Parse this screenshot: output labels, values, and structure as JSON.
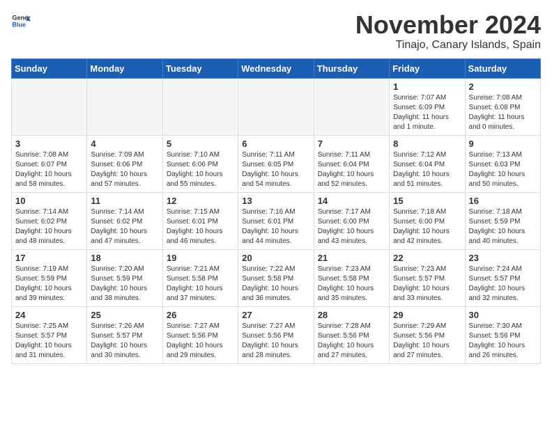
{
  "header": {
    "logo_general": "General",
    "logo_blue": "Blue",
    "month": "November 2024",
    "location": "Tinajo, Canary Islands, Spain"
  },
  "weekdays": [
    "Sunday",
    "Monday",
    "Tuesday",
    "Wednesday",
    "Thursday",
    "Friday",
    "Saturday"
  ],
  "weeks": [
    [
      {
        "day": "",
        "info": ""
      },
      {
        "day": "",
        "info": ""
      },
      {
        "day": "",
        "info": ""
      },
      {
        "day": "",
        "info": ""
      },
      {
        "day": "",
        "info": ""
      },
      {
        "day": "1",
        "info": "Sunrise: 7:07 AM\nSunset: 6:09 PM\nDaylight: 11 hours and 1 minute."
      },
      {
        "day": "2",
        "info": "Sunrise: 7:08 AM\nSunset: 6:08 PM\nDaylight: 11 hours and 0 minutes."
      }
    ],
    [
      {
        "day": "3",
        "info": "Sunrise: 7:08 AM\nSunset: 6:07 PM\nDaylight: 10 hours and 58 minutes."
      },
      {
        "day": "4",
        "info": "Sunrise: 7:09 AM\nSunset: 6:06 PM\nDaylight: 10 hours and 57 minutes."
      },
      {
        "day": "5",
        "info": "Sunrise: 7:10 AM\nSunset: 6:06 PM\nDaylight: 10 hours and 55 minutes."
      },
      {
        "day": "6",
        "info": "Sunrise: 7:11 AM\nSunset: 6:05 PM\nDaylight: 10 hours and 54 minutes."
      },
      {
        "day": "7",
        "info": "Sunrise: 7:11 AM\nSunset: 6:04 PM\nDaylight: 10 hours and 52 minutes."
      },
      {
        "day": "8",
        "info": "Sunrise: 7:12 AM\nSunset: 6:04 PM\nDaylight: 10 hours and 51 minutes."
      },
      {
        "day": "9",
        "info": "Sunrise: 7:13 AM\nSunset: 6:03 PM\nDaylight: 10 hours and 50 minutes."
      }
    ],
    [
      {
        "day": "10",
        "info": "Sunrise: 7:14 AM\nSunset: 6:02 PM\nDaylight: 10 hours and 48 minutes."
      },
      {
        "day": "11",
        "info": "Sunrise: 7:14 AM\nSunset: 6:02 PM\nDaylight: 10 hours and 47 minutes."
      },
      {
        "day": "12",
        "info": "Sunrise: 7:15 AM\nSunset: 6:01 PM\nDaylight: 10 hours and 46 minutes."
      },
      {
        "day": "13",
        "info": "Sunrise: 7:16 AM\nSunset: 6:01 PM\nDaylight: 10 hours and 44 minutes."
      },
      {
        "day": "14",
        "info": "Sunrise: 7:17 AM\nSunset: 6:00 PM\nDaylight: 10 hours and 43 minutes."
      },
      {
        "day": "15",
        "info": "Sunrise: 7:18 AM\nSunset: 6:00 PM\nDaylight: 10 hours and 42 minutes."
      },
      {
        "day": "16",
        "info": "Sunrise: 7:18 AM\nSunset: 5:59 PM\nDaylight: 10 hours and 40 minutes."
      }
    ],
    [
      {
        "day": "17",
        "info": "Sunrise: 7:19 AM\nSunset: 5:59 PM\nDaylight: 10 hours and 39 minutes."
      },
      {
        "day": "18",
        "info": "Sunrise: 7:20 AM\nSunset: 5:59 PM\nDaylight: 10 hours and 38 minutes."
      },
      {
        "day": "19",
        "info": "Sunrise: 7:21 AM\nSunset: 5:58 PM\nDaylight: 10 hours and 37 minutes."
      },
      {
        "day": "20",
        "info": "Sunrise: 7:22 AM\nSunset: 5:58 PM\nDaylight: 10 hours and 36 minutes."
      },
      {
        "day": "21",
        "info": "Sunrise: 7:23 AM\nSunset: 5:58 PM\nDaylight: 10 hours and 35 minutes."
      },
      {
        "day": "22",
        "info": "Sunrise: 7:23 AM\nSunset: 5:57 PM\nDaylight: 10 hours and 33 minutes."
      },
      {
        "day": "23",
        "info": "Sunrise: 7:24 AM\nSunset: 5:57 PM\nDaylight: 10 hours and 32 minutes."
      }
    ],
    [
      {
        "day": "24",
        "info": "Sunrise: 7:25 AM\nSunset: 5:57 PM\nDaylight: 10 hours and 31 minutes."
      },
      {
        "day": "25",
        "info": "Sunrise: 7:26 AM\nSunset: 5:57 PM\nDaylight: 10 hours and 30 minutes."
      },
      {
        "day": "26",
        "info": "Sunrise: 7:27 AM\nSunset: 5:56 PM\nDaylight: 10 hours and 29 minutes."
      },
      {
        "day": "27",
        "info": "Sunrise: 7:27 AM\nSunset: 5:56 PM\nDaylight: 10 hours and 28 minutes."
      },
      {
        "day": "28",
        "info": "Sunrise: 7:28 AM\nSunset: 5:56 PM\nDaylight: 10 hours and 27 minutes."
      },
      {
        "day": "29",
        "info": "Sunrise: 7:29 AM\nSunset: 5:56 PM\nDaylight: 10 hours and 27 minutes."
      },
      {
        "day": "30",
        "info": "Sunrise: 7:30 AM\nSunset: 5:56 PM\nDaylight: 10 hours and 26 minutes."
      }
    ]
  ]
}
